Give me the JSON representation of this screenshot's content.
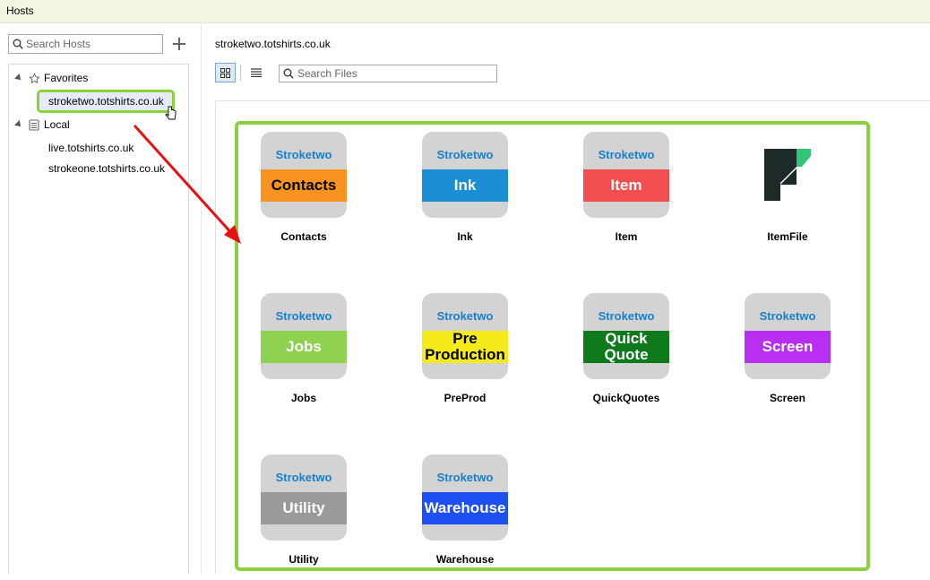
{
  "window": {
    "title": "Hosts"
  },
  "sidebar": {
    "search_placeholder": "Search Hosts",
    "favorites_label": "Favorites",
    "favorites": [
      "stroketwo.totshirts.co.uk"
    ],
    "local_label": "Local",
    "local": [
      "live.totshirts.co.uk",
      "strokeone.totshirts.co.uk"
    ]
  },
  "main": {
    "host_title": "stroketwo.totshirts.co.uk",
    "search_placeholder": "Search Files"
  },
  "files": [
    {
      "name": "Contacts",
      "brand": "Stroketwo",
      "band": "Contacts",
      "band_color": "#f7931e",
      "text_color": "#000000"
    },
    {
      "name": "Ink",
      "brand": "Stroketwo",
      "band": "Ink",
      "band_color": "#1b8ed6",
      "text_color": "#ffffff"
    },
    {
      "name": "Item",
      "brand": "Stroketwo",
      "band": "Item",
      "band_color": "#f24e4e",
      "text_color": "#ffffff"
    },
    {
      "name": "ItemFile",
      "icon": "filemaker-logo-icon"
    },
    {
      "name": "Jobs",
      "brand": "Stroketwo",
      "band": "Jobs",
      "band_color": "#8ed151",
      "text_color": "#ffffff"
    },
    {
      "name": "PreProd",
      "brand": "Stroketwo",
      "band": "Pre Production",
      "band_color": "#f5ea1a",
      "text_color": "#000000"
    },
    {
      "name": "QuickQuotes",
      "brand": "Stroketwo",
      "band": "Quick Quote",
      "band_color": "#0e7a1c",
      "text_color": "#ffffff"
    },
    {
      "name": "Screen",
      "brand": "Stroketwo",
      "band": "Screen",
      "band_color": "#b82ef2",
      "text_color": "#ffffff"
    },
    {
      "name": "Utility",
      "brand": "Stroketwo",
      "band": "Utility",
      "band_color": "#9a9a9a",
      "text_color": "#ffffff"
    },
    {
      "name": "Warehouse",
      "brand": "Stroketwo",
      "band": "Warehouse",
      "band_color": "#1e4ff0",
      "text_color": "#ffffff"
    }
  ],
  "colors": {
    "highlight": "#8bd13f",
    "arrow": "#e81010",
    "brand_text": "#1a7ecb"
  }
}
